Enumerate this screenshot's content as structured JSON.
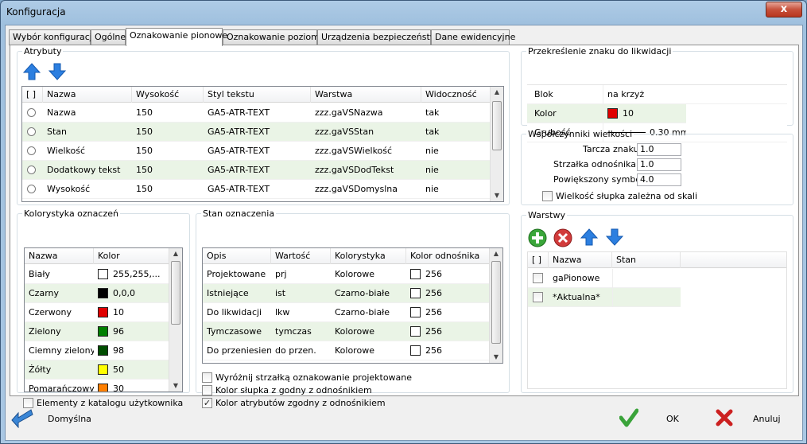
{
  "window": {
    "title": "Konfiguracja",
    "close": "x"
  },
  "tabs": [
    "Wybór konfiguracji",
    "Ogólne",
    "Oznakowanie pionowe",
    "Oznakowanie poziome",
    "Urządzenia bezpieczeństwa",
    "Dane ewidencyjne"
  ],
  "attributes": {
    "legend": "Atrybuty",
    "headers": [
      "[ ]",
      "Nazwa",
      "Wysokość",
      "Styl tekstu",
      "Warstwa",
      "Widoczność"
    ],
    "rows": [
      {
        "name": "Nazwa",
        "height": "150",
        "style": "GA5-ATR-TEXT",
        "layer": "zzz.gaVSNazwa",
        "visible": "tak"
      },
      {
        "name": "Stan",
        "height": "150",
        "style": "GA5-ATR-TEXT",
        "layer": "zzz.gaVSStan",
        "visible": "tak"
      },
      {
        "name": "Wielkość",
        "height": "150",
        "style": "GA5-ATR-TEXT",
        "layer": "zzz.gaVSWielkość",
        "visible": "nie"
      },
      {
        "name": "Dodatkowy tekst",
        "height": "150",
        "style": "GA5-ATR-TEXT",
        "layer": "zzz.gaVSDodTekst",
        "visible": "nie"
      },
      {
        "name": "Wysokość",
        "height": "150",
        "style": "GA5-ATR-TEXT",
        "layer": "zzz.gaVSDomyslna",
        "visible": "nie"
      }
    ]
  },
  "strike": {
    "legend": "Przekreślenie znaku do likwidacji",
    "block_label": "Blok",
    "block_value": "na krzyż",
    "color_label": "Kolor",
    "color_value": "10",
    "color_hex": "#e00000",
    "thickness_label": "Grubość",
    "thickness_value": "0.30 mm"
  },
  "coef": {
    "legend": "Współczynniki wielkości",
    "shield_label": "Tarcza znaku",
    "shield_value": "1.0",
    "arrow_label": "Strzałka odnośnika",
    "arrow_value": "1.0",
    "enlarged_label": "Powiększony symbol",
    "enlarged_value": "4.0",
    "scale_label": "Wielkość słupka zależna od skali"
  },
  "colors": {
    "legend": "Kolorystyka oznaczeń",
    "headers": [
      "Nazwa",
      "Kolor"
    ],
    "rows": [
      {
        "name": "Biały",
        "value": "255,255,...",
        "hex": "#ffffff"
      },
      {
        "name": "Czarny",
        "value": "0,0,0",
        "hex": "#000000"
      },
      {
        "name": "Czerwony",
        "value": "10",
        "hex": "#e00000"
      },
      {
        "name": "Zielony",
        "value": "96",
        "hex": "#008000"
      },
      {
        "name": "Ciemny zielony",
        "value": "98",
        "hex": "#004d00"
      },
      {
        "name": "Żółty",
        "value": "50",
        "hex": "#ffff00"
      },
      {
        "name": "Pomarańczowy",
        "value": "30",
        "hex": "#ff7f00"
      }
    ],
    "user_catalog_label": "Elementy z katalogu użytkownika"
  },
  "state": {
    "legend": "Stan oznaczenia",
    "headers": [
      "Opis",
      "Wartość",
      "Kolorystyka",
      "Kolor odnośnika"
    ],
    "rows": [
      {
        "desc": "Projektowane",
        "value": "prj",
        "scheme": "Kolorowe",
        "color": "256"
      },
      {
        "desc": "Istniejące",
        "value": "ist",
        "scheme": "Czarno-białe",
        "color": "256"
      },
      {
        "desc": "Do likwidacji",
        "value": "lkw",
        "scheme": "Czarno-białe",
        "color": "256"
      },
      {
        "desc": "Tymczasowe",
        "value": "tymczas",
        "scheme": "Kolorowe",
        "color": "256"
      },
      {
        "desc": "Do przeniesienia",
        "value": "do przen.",
        "scheme": "Kolorowe",
        "color": "256"
      }
    ],
    "opt1": "Wyróżnij strzałką oznakowanie projektowane",
    "opt2": "Kolor słupka z godny z odnośnikiem",
    "opt3": "Kolor atrybutów zgodny z odnośnikiem"
  },
  "layers": {
    "legend": "Warstwy",
    "headers": [
      "[ ]",
      "Nazwa",
      "Stan"
    ],
    "rows": [
      {
        "name": "gaPionowe",
        "state": ""
      },
      {
        "name": "*Aktualna*",
        "state": ""
      }
    ]
  },
  "footer": {
    "default_label": "Domyślna",
    "ok_label": "OK",
    "cancel_label": "Anuluj"
  }
}
